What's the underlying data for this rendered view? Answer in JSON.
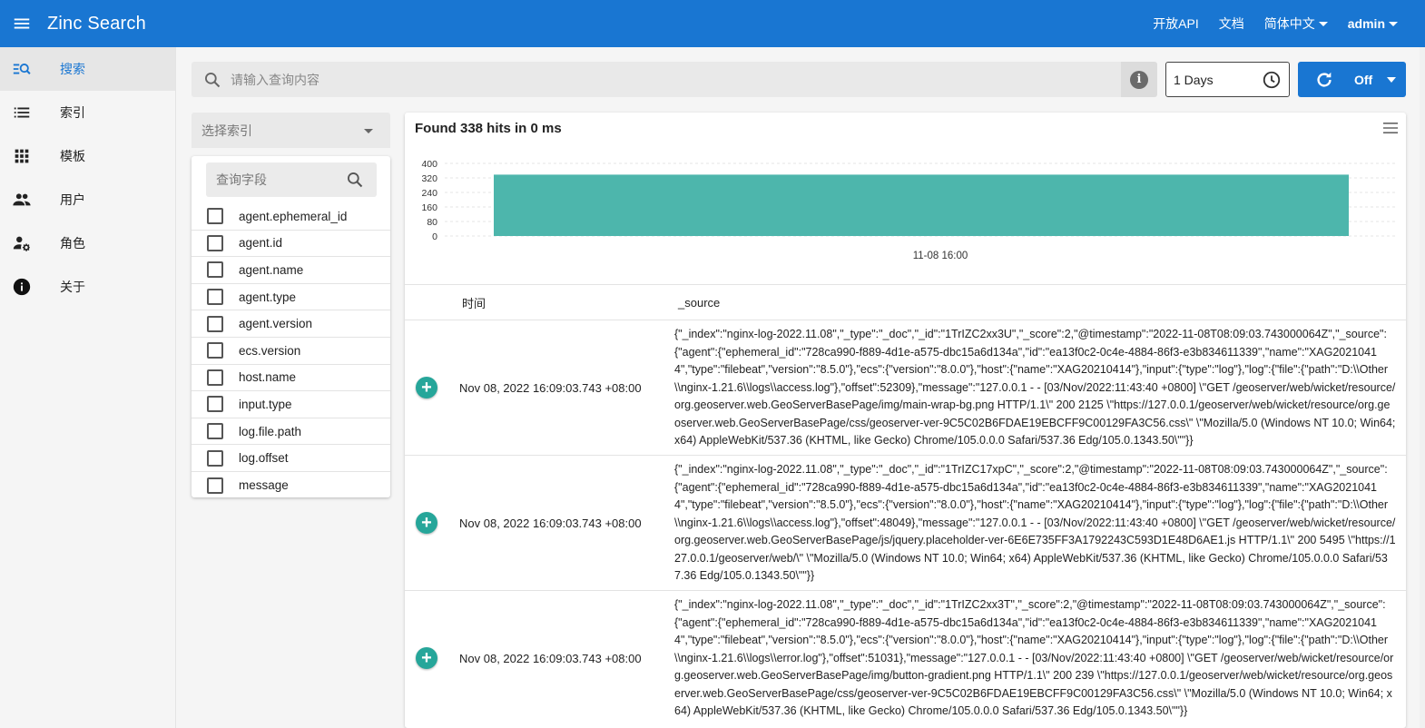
{
  "header": {
    "title": "Zinc Search",
    "links": [
      "开放API",
      "文档"
    ],
    "language": "简体中文",
    "user": "admin"
  },
  "sidebar": {
    "items": [
      {
        "label": "搜索",
        "icon": "search-list-icon",
        "active": true
      },
      {
        "label": "索引",
        "icon": "list-icon"
      },
      {
        "label": "模板",
        "icon": "grid-icon"
      },
      {
        "label": "用户",
        "icon": "people-icon"
      },
      {
        "label": "角色",
        "icon": "user-settings-icon"
      },
      {
        "label": "关于",
        "icon": "info-icon"
      }
    ]
  },
  "search": {
    "placeholder": "请输入查询内容",
    "time_range": "1 Days",
    "refresh_label": "Off"
  },
  "index_select": {
    "placeholder": "选择索引"
  },
  "fields": {
    "search_placeholder": "查询字段",
    "items": [
      "agent.ephemeral_id",
      "agent.id",
      "agent.name",
      "agent.type",
      "agent.version",
      "ecs.version",
      "host.name",
      "input.type",
      "log.file.path",
      "log.offset",
      "message"
    ]
  },
  "results": {
    "hits_title": "Found 338 hits in 0 ms",
    "columns": [
      "时间",
      "_source"
    ],
    "rows": [
      {
        "time": "Nov 08, 2022 16:09:03.743 +08:00",
        "source": "{\"_index\":\"nginx-log-2022.11.08\",\"_type\":\"_doc\",\"_id\":\"1TrIZC2xx3U\",\"_score\":2,\"@timestamp\":\"2022-11-08T08:09:03.743000064Z\",\"_source\":{\"agent\":{\"ephemeral_id\":\"728ca990-f889-4d1e-a575-dbc15a6d134a\",\"id\":\"ea13f0c2-0c4e-4884-86f3-e3b834611339\",\"name\":\"XAG20210414\",\"type\":\"filebeat\",\"version\":\"8.5.0\"},\"ecs\":{\"version\":\"8.0.0\"},\"host\":{\"name\":\"XAG20210414\"},\"input\":{\"type\":\"log\"},\"log\":{\"file\":{\"path\":\"D:\\\\Other\\\\nginx-1.21.6\\\\logs\\\\access.log\"},\"offset\":52309},\"message\":\"127.0.0.1 - - [03/Nov/2022:11:43:40 +0800] \\\"GET /geoserver/web/wicket/resource/org.geoserver.web.GeoServerBasePage/img/main-wrap-bg.png HTTP/1.1\\\" 200 2125 \\\"https://127.0.0.1/geoserver/web/wicket/resource/org.geoserver.web.GeoServerBasePage/css/geoserver-ver-9C5C02B6FDAE19EBCFF9C00129FA3C56.css\\\" \\\"Mozilla/5.0 (Windows NT 10.0; Win64; x64) AppleWebKit/537.36 (KHTML, like Gecko) Chrome/105.0.0.0 Safari/537.36 Edg/105.0.1343.50\\\"\"}}"
      },
      {
        "time": "Nov 08, 2022 16:09:03.743 +08:00",
        "source": "{\"_index\":\"nginx-log-2022.11.08\",\"_type\":\"_doc\",\"_id\":\"1TrIZC17xpC\",\"_score\":2,\"@timestamp\":\"2022-11-08T08:09:03.743000064Z\",\"_source\":{\"agent\":{\"ephemeral_id\":\"728ca990-f889-4d1e-a575-dbc15a6d134a\",\"id\":\"ea13f0c2-0c4e-4884-86f3-e3b834611339\",\"name\":\"XAG20210414\",\"type\":\"filebeat\",\"version\":\"8.5.0\"},\"ecs\":{\"version\":\"8.0.0\"},\"host\":{\"name\":\"XAG20210414\"},\"input\":{\"type\":\"log\"},\"log\":{\"file\":{\"path\":\"D:\\\\Other\\\\nginx-1.21.6\\\\logs\\\\access.log\"},\"offset\":48049},\"message\":\"127.0.0.1 - - [03/Nov/2022:11:43:40 +0800] \\\"GET /geoserver/web/wicket/resource/org.geoserver.web.GeoServerBasePage/js/jquery.placeholder-ver-6E6E735FF3A1792243C593D1E48D6AE1.js HTTP/1.1\\\" 200 5495 \\\"https://127.0.0.1/geoserver/web/\\\" \\\"Mozilla/5.0 (Windows NT 10.0; Win64; x64) AppleWebKit/537.36 (KHTML, like Gecko) Chrome/105.0.0.0 Safari/537.36 Edg/105.0.1343.50\\\"\"}}"
      },
      {
        "time": "Nov 08, 2022 16:09:03.743 +08:00",
        "source": "{\"_index\":\"nginx-log-2022.11.08\",\"_type\":\"_doc\",\"_id\":\"1TrIZC2xx3T\",\"_score\":2,\"@timestamp\":\"2022-11-08T08:09:03.743000064Z\",\"_source\":{\"agent\":{\"ephemeral_id\":\"728ca990-f889-4d1e-a575-dbc15a6d134a\",\"id\":\"ea13f0c2-0c4e-4884-86f3-e3b834611339\",\"name\":\"XAG20210414\",\"type\":\"filebeat\",\"version\":\"8.5.0\"},\"ecs\":{\"version\":\"8.0.0\"},\"host\":{\"name\":\"XAG20210414\"},\"input\":{\"type\":\"log\"},\"log\":{\"file\":{\"path\":\"D:\\\\Other\\\\nginx-1.21.6\\\\logs\\\\error.log\"},\"offset\":51031},\"message\":\"127.0.0.1 - - [03/Nov/2022:11:43:40 +0800] \\\"GET /geoserver/web/wicket/resource/org.geoserver.web.GeoServerBasePage/img/button-gradient.png HTTP/1.1\\\" 200 239 \\\"https://127.0.0.1/geoserver/web/wicket/resource/org.geoserver.web.GeoServerBasePage/css/geoserver-ver-9C5C02B6FDAE19EBCFF9C00129FA3C56.css\\\" \\\"Mozilla/5.0 (Windows NT 10.0; Win64; x64) AppleWebKit/537.36 (KHTML, like Gecko) Chrome/105.0.0.0 Safari/537.36 Edg/105.0.1343.50\\\"\"}}"
      }
    ]
  },
  "colors": {
    "primary": "#1976d2",
    "bar": "#4db6ac",
    "expand_button": "#26a69a"
  },
  "chart_data": {
    "type": "bar",
    "categories": [
      "11-08 16:00"
    ],
    "values": [
      338
    ],
    "yticks": [
      "0",
      "80",
      "160",
      "240",
      "320",
      "400"
    ],
    "ylim": [
      0,
      400
    ],
    "xlabel": "",
    "ylabel": "",
    "title": ""
  }
}
